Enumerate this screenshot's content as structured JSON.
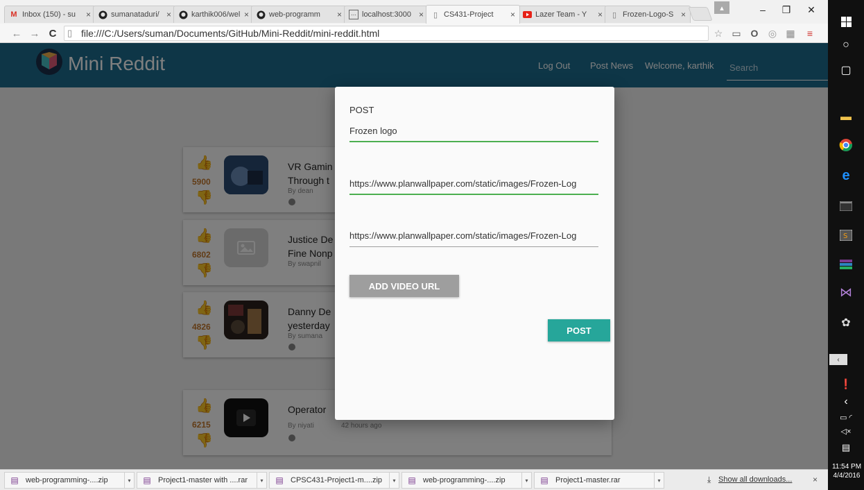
{
  "browser": {
    "tabs": [
      {
        "title": "Inbox (150) - su",
        "icon": "gmail-icon"
      },
      {
        "title": "sumanataduri/",
        "icon": "github-icon"
      },
      {
        "title": "karthik006/wel",
        "icon": "github-icon"
      },
      {
        "title": "web-programm",
        "icon": "github-icon"
      },
      {
        "title": "localhost:3000",
        "icon": "local-icon"
      },
      {
        "title": "CS431-Project",
        "icon": "page-icon",
        "active": true
      },
      {
        "title": "Lazer Team - Y",
        "icon": "youtube-icon"
      },
      {
        "title": "Frozen-Logo-S",
        "icon": "page-icon"
      }
    ],
    "url": "file:///C:/Users/suman/Documents/GitHub/Mini-Reddit/mini-reddit.html"
  },
  "app": {
    "title": "Mini Reddit",
    "nav": {
      "logout": "Log Out",
      "post_news": "Post News",
      "welcome": "Welcome, karthik"
    },
    "search_placeholder": "Search"
  },
  "posts": [
    {
      "score": "5900",
      "title": "VR Gamin\nThrough t",
      "author": "By dean",
      "age": ""
    },
    {
      "score": "6802",
      "title": "Justice De\nFine Nonp",
      "author": "By swapnil",
      "age": ""
    },
    {
      "score": "4826",
      "title": "Danny De\nyesterday",
      "author": "By sumana",
      "age": ""
    },
    {
      "score": "6215",
      "title": "Operator",
      "author": "By niyati",
      "age": "42 hours ago"
    }
  ],
  "modal": {
    "heading": "POST",
    "title_value": "Frozen logo",
    "url_value": "https://www.planwallpaper.com/static/images/Frozen-Log",
    "image_value": "https://www.planwallpaper.com/static/images/Frozen-Log",
    "add_video_label": "ADD VIDEO URL",
    "post_label": "POST"
  },
  "downloads": {
    "items": [
      "web-programming-....zip",
      "Project1-master with ....rar",
      "CPSC431-Project1-m....zip",
      "web-programming-....zip",
      "Project1-master.rar"
    ],
    "show_all": "Show all downloads...",
    "close": "×"
  },
  "taskbar": {
    "time": "11:54 PM",
    "date": "4/4/2016"
  },
  "colors": {
    "header": "#1c6c8e",
    "vote": "#c4792d",
    "post_button": "#26a69a",
    "add_video_button": "#9e9e9e",
    "valid_underline": "#4caf50"
  }
}
